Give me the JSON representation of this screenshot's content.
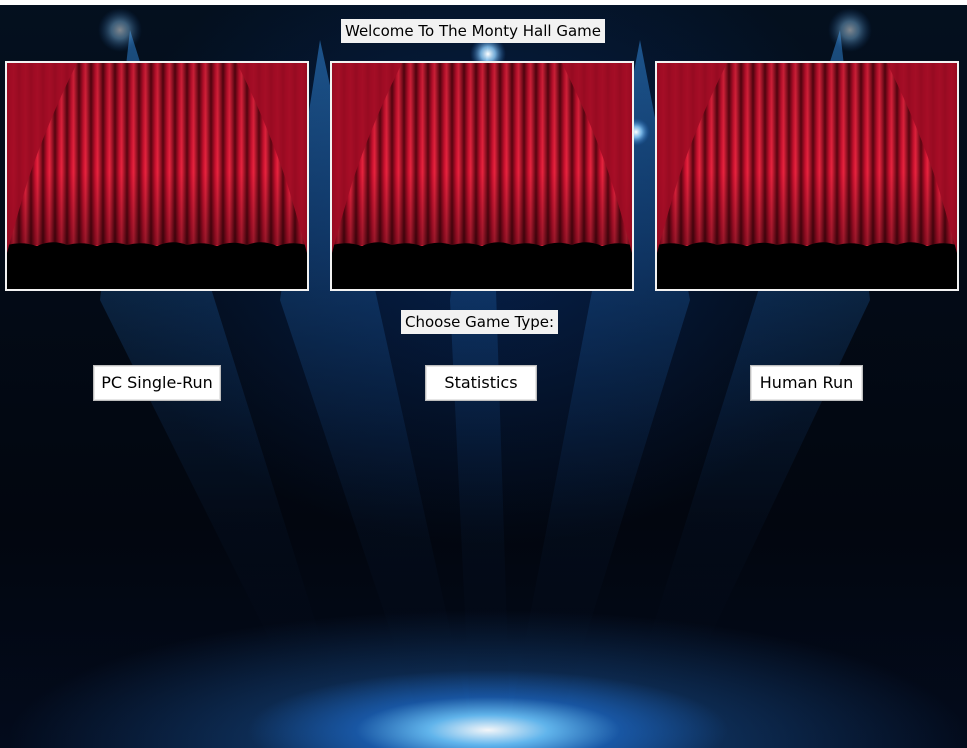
{
  "app": {
    "title": "Welcome To The Monty Hall Game",
    "prompt": "Choose Game Type:"
  },
  "doors": [
    {
      "image": "curtain-image"
    },
    {
      "image": "curtain-image"
    },
    {
      "image": "curtain-image"
    }
  ],
  "buttons": {
    "pc_single_run": "PC Single-Run",
    "statistics": "Statistics",
    "human_run": "Human Run"
  },
  "colors": {
    "background": "#02060f",
    "spotlight": "#3aa0ff",
    "curtain": "#c8102e",
    "label_bg": "#f2f2f2"
  }
}
